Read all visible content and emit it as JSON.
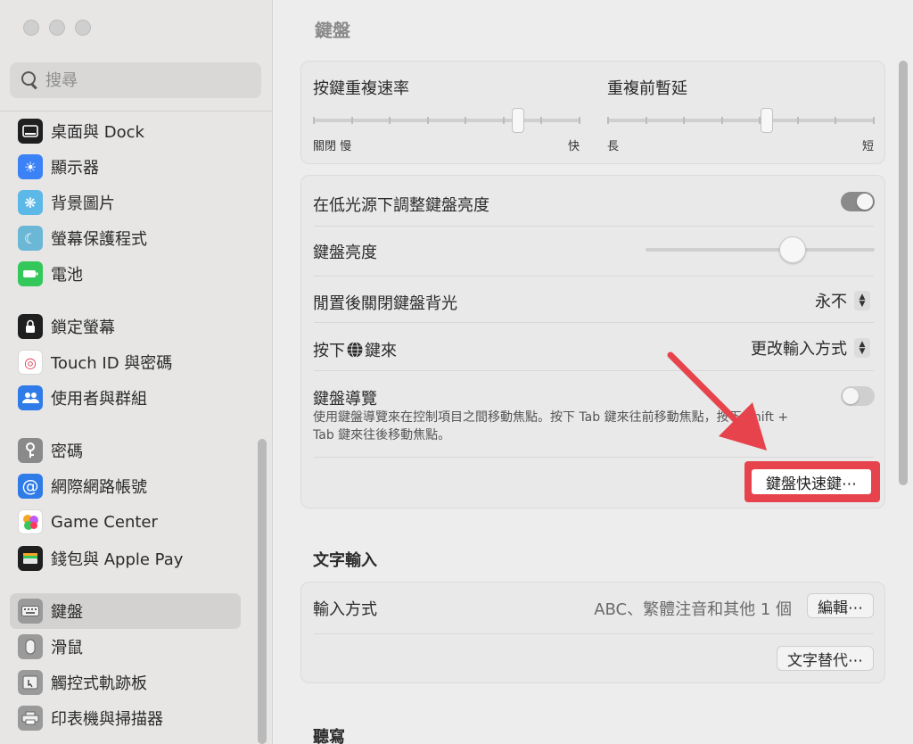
{
  "sidebar": {
    "search_placeholder": "搜尋",
    "items": [
      {
        "label": "桌面與 Dock",
        "icon": "dock-icon",
        "color": "#1f1f1f"
      },
      {
        "label": "顯示器",
        "icon": "display-icon",
        "color": "#3b82f6"
      },
      {
        "label": "背景圖片",
        "icon": "wallpaper-icon",
        "color": "#5cb8e6"
      },
      {
        "label": "螢幕保護程式",
        "icon": "screensaver-icon",
        "color": "#6bb7d6"
      },
      {
        "label": "電池",
        "icon": "battery-icon",
        "color": "#34c759"
      },
      {
        "label": "鎖定螢幕",
        "icon": "lock-icon",
        "color": "#1f1f1f"
      },
      {
        "label": "Touch ID 與密碼",
        "icon": "fingerprint-icon",
        "color": "#ffffff"
      },
      {
        "label": "使用者與群組",
        "icon": "users-icon",
        "color": "#2f7ce8"
      },
      {
        "label": "密碼",
        "icon": "key-icon",
        "color": "#8a8a8a"
      },
      {
        "label": "網際網路帳號",
        "icon": "at-icon",
        "color": "#2f7ce8"
      },
      {
        "label": "Game Center",
        "icon": "game-center-icon",
        "color": "#ffffff"
      },
      {
        "label": "錢包與 Apple Pay",
        "icon": "wallet-icon",
        "color": "#1f1f1f"
      },
      {
        "label": "鍵盤",
        "icon": "keyboard-icon",
        "color": "#9a9a9a"
      },
      {
        "label": "滑鼠",
        "icon": "mouse-icon",
        "color": "#9a9a9a"
      },
      {
        "label": "觸控式軌跡板",
        "icon": "trackpad-icon",
        "color": "#9a9a9a"
      },
      {
        "label": "印表機與掃描器",
        "icon": "printer-icon",
        "color": "#9a9a9a"
      }
    ]
  },
  "main": {
    "title": "鍵盤",
    "key_repeat": {
      "title": "按鍵重複速率",
      "left_labels": "關閉  慢",
      "right_label": "快",
      "value": 0.78
    },
    "repeat_delay": {
      "title": "重複前暫延",
      "left_label": "長",
      "right_label": "短",
      "value": 0.6
    },
    "low_light": {
      "label": "在低光源下調整鍵盤亮度",
      "on": true
    },
    "brightness": {
      "label": "鍵盤亮度",
      "value": 0.66
    },
    "backlight_off": {
      "label": "閒置後關閉鍵盤背光",
      "value": "永不"
    },
    "press_key": {
      "label_prefix": "按下",
      "label_suffix": "鍵來",
      "value": "更改輸入方式"
    },
    "keyboard_nav": {
      "label": "鍵盤導覽",
      "description": "使用鍵盤導覽來在控制項目之間移動焦點。按下 Tab 鍵來往前移動焦點，按下 Shift + Tab 鍵來往後移動焦點。",
      "on": false
    },
    "shortcuts_button": "鍵盤快速鍵⋯",
    "text_input": {
      "section_title": "文字輸入",
      "input_sources_label": "輸入方式",
      "input_sources_value": "ABC、繁體注音和其他 1 個",
      "edit_button": "編輯⋯",
      "text_replacements_button": "文字替代⋯"
    },
    "dictation": {
      "section_title": "聽寫"
    }
  },
  "colors": {
    "highlight": "#e7434c",
    "arrow": "#e7434c",
    "toggle_on": "#8a8a8a",
    "toggle_off": "#cfcfcf"
  }
}
